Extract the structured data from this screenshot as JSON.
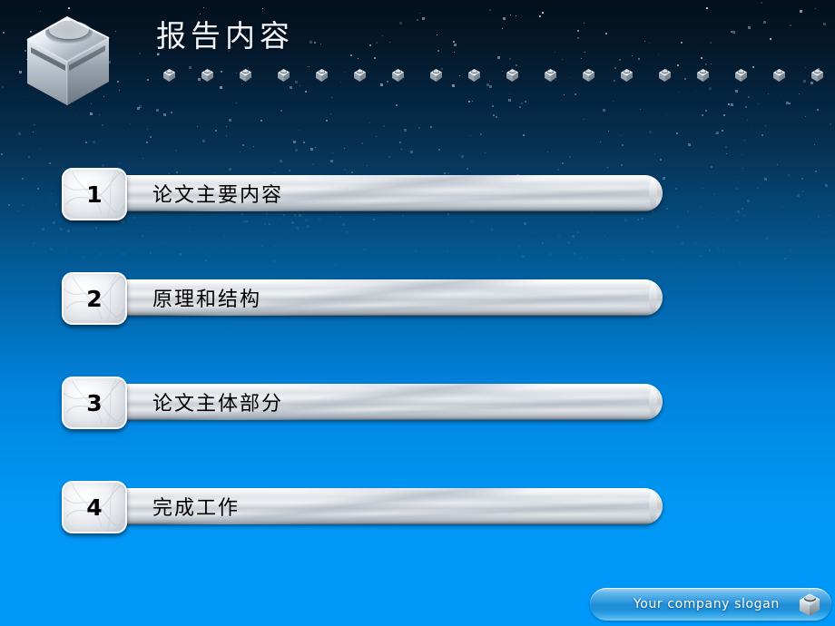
{
  "slide": {
    "title": "报告内容",
    "logo_icon": "cube-icon",
    "decor_icon": "mini-cube-icon",
    "background_colors": {
      "top": "#03101c",
      "mid": "#035a96",
      "bottom": "#0099fa"
    },
    "bar_color": "#dfe3e7",
    "text_color": "#000000",
    "title_color": "#f2f6fa"
  },
  "agenda": {
    "items": [
      {
        "number": "1",
        "label": "论文主要内容"
      },
      {
        "number": "2",
        "label": "原理和结构"
      },
      {
        "number": "3",
        "label": "论文主体部分"
      },
      {
        "number": "4",
        "label": "完成工作"
      }
    ]
  },
  "footer": {
    "slogan": "Your company slogan",
    "icon": "cube-icon",
    "accent_color": "#1e8ed6"
  }
}
